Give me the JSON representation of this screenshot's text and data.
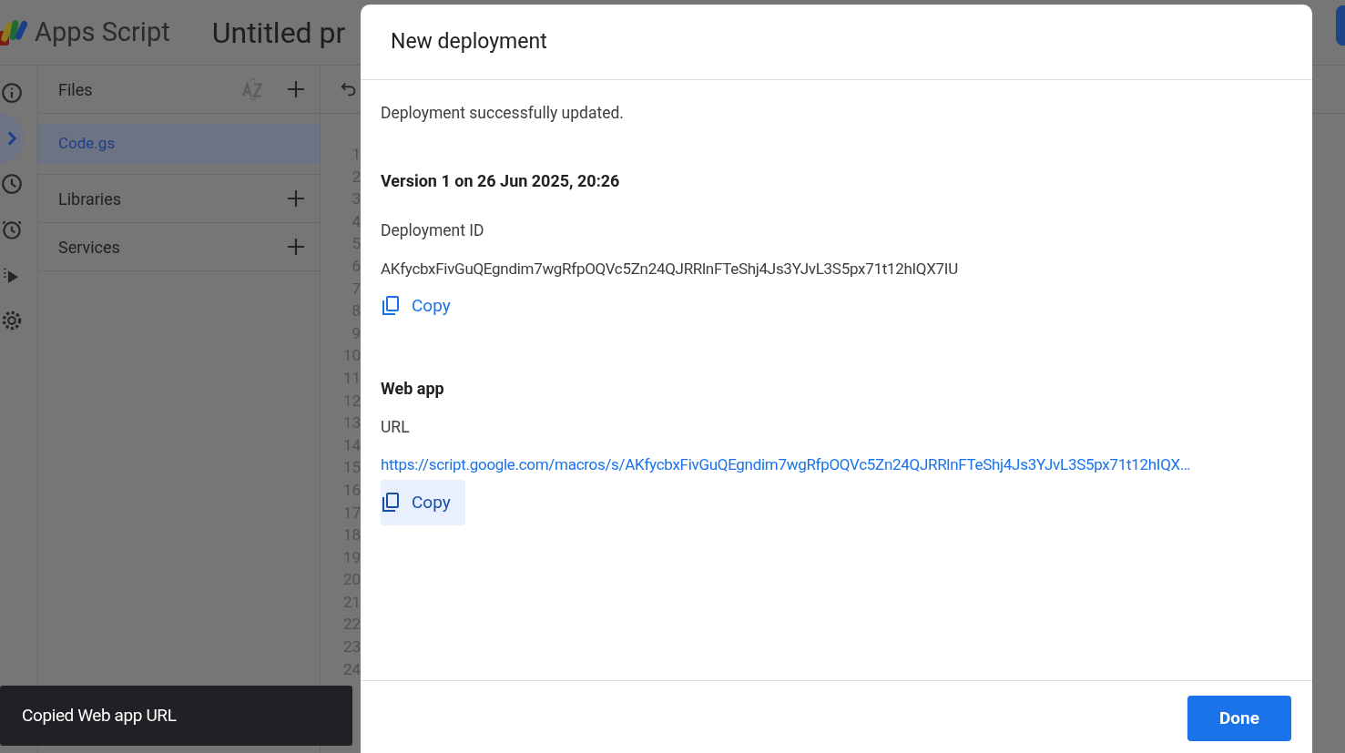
{
  "app": {
    "logo_text": "Apps Script",
    "project_title": "Untitled pr",
    "rail": [
      {
        "kind": "info",
        "selected": false
      },
      {
        "kind": "code",
        "selected": true
      },
      {
        "kind": "history",
        "selected": false
      },
      {
        "kind": "alarm",
        "selected": false
      },
      {
        "kind": "executions",
        "selected": false
      },
      {
        "kind": "settings",
        "selected": false
      }
    ],
    "sections": [
      {
        "label": "Files",
        "sortable": true,
        "files": [
          {
            "name": "Code.gs",
            "selected": true
          }
        ]
      },
      {
        "label": "Libraries",
        "sortable": false
      },
      {
        "label": "Services",
        "sortable": false
      }
    ],
    "line_numbers": [
      "1",
      "2",
      "3",
      "4",
      "5",
      "6",
      "7",
      "8",
      "9",
      "10",
      "11",
      "12",
      "13",
      "14",
      "15",
      "16",
      "17",
      "18",
      "19",
      "20",
      "21",
      "22",
      "23",
      "24"
    ]
  },
  "dialog": {
    "title": "New deployment",
    "message": "Deployment successfully updated.",
    "version": "Version 1 on 26 Jun 2025, 20:26",
    "blocks": [
      {
        "label": "Deployment ID",
        "value": "AKfycbxFivGuQEgndim7wgRfpOQVc5Zn24QJRRlnFTeShj4Js3YJvL3S5px71t12hIQX7IU",
        "kind": "text",
        "copy": {
          "label": "Copy",
          "focused": false
        }
      },
      {
        "heading": "Web app",
        "label": "URL",
        "value": "https://script.google.com/macros/s/AKfycbxFivGuQEgndim7wgRfpOQVc5Zn24QJRRlnFTeShj4Js3YJvL3S5px71t12hIQX…",
        "kind": "link",
        "copy": {
          "label": "Copy",
          "focused": true
        }
      }
    ],
    "done": "Done"
  },
  "toast": {
    "text": "Copied Web app URL"
  }
}
